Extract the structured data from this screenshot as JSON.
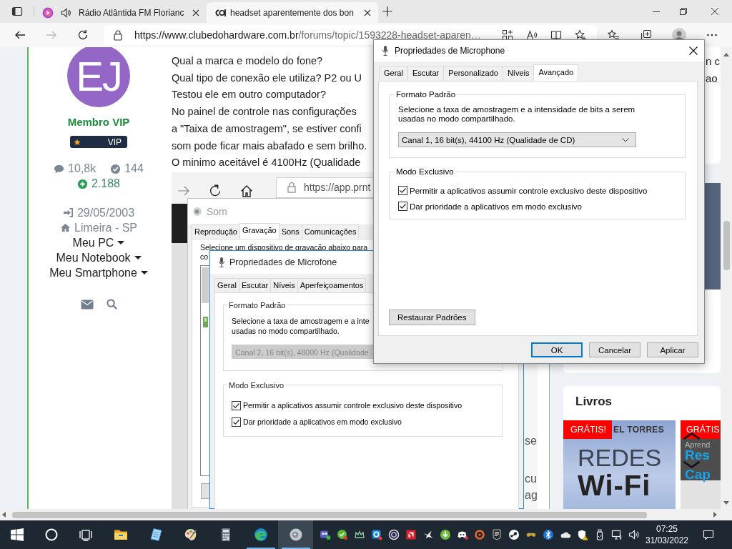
{
  "browser": {
    "tabs": [
      {
        "title": "Rádio Atlântida FM Florianc",
        "selected": false
      },
      {
        "title": "headset aparentemente dos bon",
        "selected": true
      }
    ],
    "forward_disabled": true,
    "url_host": "https://www.clubedohardware.com.br",
    "url_path": "/forums/topic/1593228-headset-aparen…"
  },
  "author": {
    "initials": "EJ",
    "rank": "Membro VIP",
    "badge": "VIP",
    "posts": "10,8k",
    "solutions": "144",
    "reputation": "2.188",
    "joined": "29/05/2003",
    "location": "Limeira - SP",
    "menus": [
      "Meu PC",
      "Meu Notebook",
      "Meu Smartphone"
    ]
  },
  "post": {
    "lines": [
      "Qual a marca e modelo do fone?",
      "Qual tipo de conexão ele utiliza? P2 ou U",
      "Testou ele em outro computador?",
      "No painel de controle nas configurações",
      "a \"Taixa de amostragem\", se estiver confi",
      "som pode ficar mais abafado e sem brilho.",
      "O minimo aceitável é 4100Hz (Qualidade"
    ],
    "screenshot": {
      "url": "https://app.prnt",
      "window_title": "Som",
      "tabs": [
        {
          "label": "Reprodução",
          "selected": false
        },
        {
          "label": "Gravação",
          "selected": true
        },
        {
          "label": "Sons",
          "selected": false
        },
        {
          "label": "Comunicações",
          "selected": false
        }
      ],
      "instruction_lines": [
        "Selecione um dispositivo de gravação abaixo para",
        "co"
      ],
      "dialog": {
        "title": "Propriedades de Microfone",
        "tabs": [
          {
            "label": "Geral",
            "selected": false
          },
          {
            "label": "Escutar",
            "selected": false
          },
          {
            "label": "Níveis",
            "selected": false
          },
          {
            "label": "Aperfeiçoamentos",
            "selected": false
          }
        ],
        "format_group": "Formato Padrão",
        "format_help_lines": [
          "Selecione a taxa de amostragem e a inte",
          "usadas no modo compartilhado."
        ],
        "format_value": "Canal 2, 16 bit(s), 48000 Hz (Qualidade",
        "format_disabled": true,
        "exclusive_group": "Modo Exclusivo",
        "options": [
          {
            "label": "Permitir a aplicativos assumir controle exclusivo deste dispositivo",
            "checked": true
          },
          {
            "label": "Dar prioridade a aplicativos em modo exclusivo",
            "checked": true
          }
        ]
      },
      "page_fragments": [
        "se",
        "cu",
        "ag"
      ]
    }
  },
  "sidebar": {
    "card_lines": [
      "n c",
      "ao"
    ],
    "books": {
      "title": "Livros",
      "items": [
        {
          "badge": "GRÁTIS!",
          "cover_lines": [
            "EL TORRES",
            "REDES",
            "Wi-Fi"
          ]
        },
        {
          "badge": "GRÁTIS",
          "cover_lines": [
            "Aprend",
            "Res",
            "Cap"
          ]
        }
      ]
    }
  },
  "dialog": {
    "title": "Propriedades de Microphone",
    "tabs": [
      {
        "label": "Geral",
        "selected": false
      },
      {
        "label": "Escutar",
        "selected": false
      },
      {
        "label": "Personalizado",
        "selected": false
      },
      {
        "label": "Níveis",
        "selected": false
      },
      {
        "label": "Avançado",
        "selected": true
      }
    ],
    "format_group": "Formato Padrão",
    "format_help": "Selecione a taxa de amostragem e a intensidade de bits a serem usadas no modo compartilhado.",
    "format_value": "Canal 1, 16 bit(s), 44100 Hz (Qualidade de CD)",
    "exclusive_group": "Modo Exclusivo",
    "options": [
      {
        "label": "Permitir a aplicativos assumir controle exclusivo deste dispositivo",
        "checked": true
      },
      {
        "label": "Dar prioridade a aplicativos em modo exclusivo",
        "checked": true
      }
    ],
    "restore_button": "Restaurar Padrões",
    "buttons": [
      {
        "label": "OK",
        "default": true
      },
      {
        "label": "Cancelar",
        "default": false
      },
      {
        "label": "Aplicar",
        "default": false
      }
    ]
  },
  "taskbar": {
    "apps": [
      {
        "running": false,
        "active": false
      },
      {
        "running": false,
        "active": false
      },
      {
        "running": false,
        "active": false
      },
      {
        "running": false,
        "active": false
      },
      {
        "running": true,
        "active": false
      },
      {
        "running": true,
        "active": true
      }
    ],
    "time": "07:25",
    "date": "31/03/2022"
  }
}
